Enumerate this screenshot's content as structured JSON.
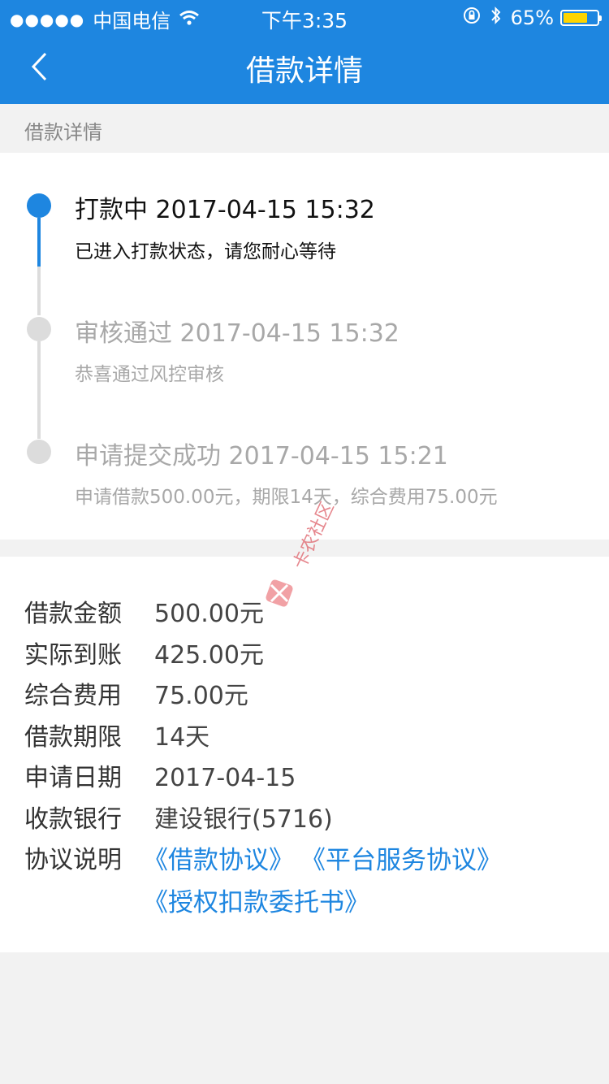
{
  "status_bar": {
    "signal_dots": "●●●●●",
    "carrier": "中国电信",
    "time": "下午3:35",
    "battery_percent": "65%",
    "battery_level": 0.65,
    "icons": [
      "wifi-icon",
      "rotation-lock-icon",
      "bluetooth-icon",
      "battery-icon"
    ]
  },
  "nav": {
    "title": "借款详情",
    "back_icon": "chevron-left-icon"
  },
  "section_label": "借款详情",
  "timeline": [
    {
      "title": "打款中 2017-04-15 15:32",
      "desc": "已进入打款状态，请您耐心等待",
      "state": "active"
    },
    {
      "title": "审核通过 2017-04-15 15:32",
      "desc": "恭喜通过风控审核",
      "state": "done"
    },
    {
      "title": "申请提交成功 2017-04-15 15:21",
      "desc": "申请借款500.00元，期限14天，综合费用75.00元",
      "state": "done"
    }
  ],
  "details": [
    {
      "label": "借款金额",
      "value": "500.00元"
    },
    {
      "label": "实际到账",
      "value": "425.00元"
    },
    {
      "label": "综合费用",
      "value": "75.00元"
    },
    {
      "label": "借款期限",
      "value": "14天"
    },
    {
      "label": "申请日期",
      "value": "2017-04-15"
    },
    {
      "label": "收款银行",
      "value": "建设银行(5716)"
    }
  ],
  "agreements": {
    "label": "协议说明",
    "links": [
      "《借款协议》",
      "《平台服务协议》",
      "《授权扣款委托书》"
    ]
  },
  "watermark": {
    "text": "卡农社区"
  },
  "colors": {
    "primary": "#1e86e0",
    "battery": "#ffd400",
    "inactive": "#a8a8a8",
    "dot_inactive": "#dcdcdc"
  }
}
